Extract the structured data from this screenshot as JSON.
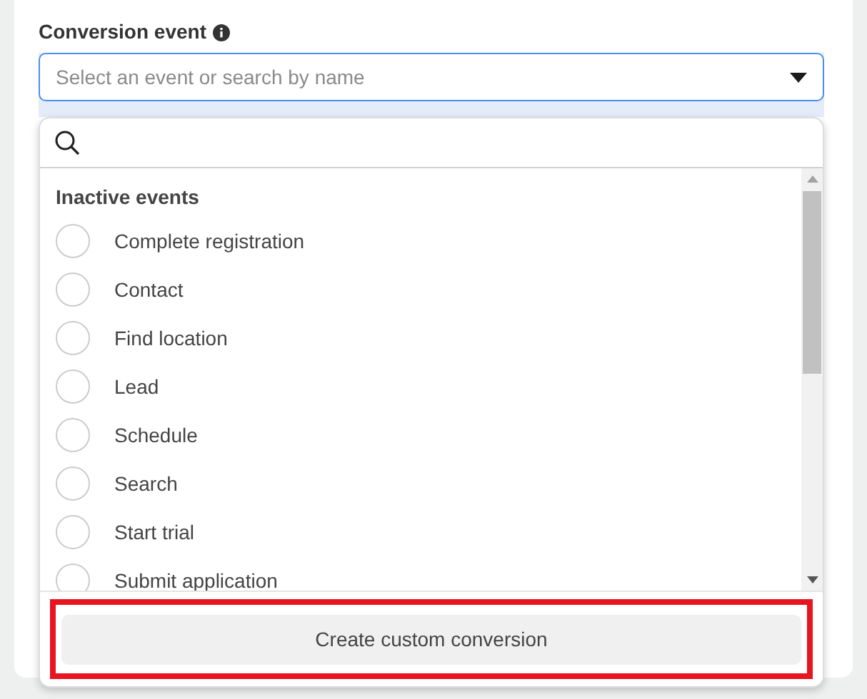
{
  "field": {
    "label": "Conversion event",
    "placeholder": "Select an event or search by name"
  },
  "dropdown": {
    "group": "Inactive events",
    "items": [
      {
        "label": "Complete registration",
        "selected": false
      },
      {
        "label": "Contact",
        "selected": false
      },
      {
        "label": "Find location",
        "selected": false
      },
      {
        "label": "Lead",
        "selected": false
      },
      {
        "label": "Schedule",
        "selected": false
      },
      {
        "label": "Search",
        "selected": false
      },
      {
        "label": "Start trial",
        "selected": false
      },
      {
        "label": "Submit application",
        "selected": false
      }
    ],
    "footer_button": "Create custom conversion"
  }
}
